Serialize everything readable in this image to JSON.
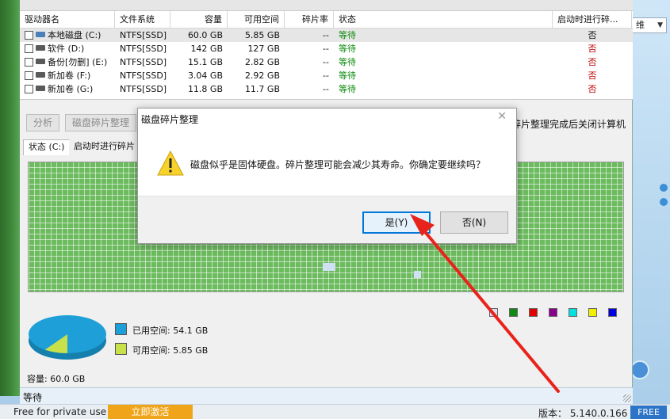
{
  "table": {
    "headers": [
      "驱动器名",
      "文件系统",
      "容量",
      "可用空间",
      "碎片率",
      "状态",
      "启动时进行碎..."
    ],
    "rows": [
      {
        "name": "本地磁盘 (C:)",
        "fs": "NTFS[SSD]",
        "capacity": "60.0 GB",
        "free": "5.85 GB",
        "frag": "--",
        "status": "等待",
        "boot": "否",
        "system": true
      },
      {
        "name": "软件 (D:)",
        "fs": "NTFS[SSD]",
        "capacity": "142 GB",
        "free": "127 GB",
        "frag": "--",
        "status": "等待",
        "boot": "否",
        "system": false
      },
      {
        "name": "备份[勿删] (E:)",
        "fs": "NTFS[SSD]",
        "capacity": "15.1 GB",
        "free": "2.82 GB",
        "frag": "--",
        "status": "等待",
        "boot": "否",
        "system": false
      },
      {
        "name": "新加卷 (F:)",
        "fs": "NTFS[SSD]",
        "capacity": "3.04 GB",
        "free": "2.92 GB",
        "frag": "--",
        "status": "等待",
        "boot": "否",
        "system": false
      },
      {
        "name": "新加卷 (G:)",
        "fs": "NTFS[SSD]",
        "capacity": "11.8 GB",
        "free": "11.7 GB",
        "frag": "--",
        "status": "等待",
        "boot": "否",
        "system": false
      }
    ]
  },
  "actions": {
    "analyze": "分析",
    "defrag": "磁盘碎片整理",
    "shutdown": "碎片整理完成后关闭计算机"
  },
  "tabs": {
    "status": "状态 (C:)",
    "boot": "启动时进行碎片"
  },
  "usage": {
    "used_label": "已用空间: 54.1 GB",
    "free_label": "可用空间: 5.85 GB",
    "used_value": 54.1,
    "free_value": 5.85,
    "used_color": "#1e9fd8",
    "free_color": "#c8e04a",
    "capacity": "容量: 60.0 GB"
  },
  "legend_colors": [
    "#e0e0f0",
    "#108a10",
    "#e00000",
    "#8b008b",
    "#00e0e0",
    "#f0f000",
    "#0000e0"
  ],
  "status_bar": "等待",
  "bottom": {
    "free_private": "Free for private use",
    "activate": "立即激活",
    "version": "版本：  5.140.0.166",
    "free_badge": "FREE"
  },
  "right_combo": "维",
  "dialog": {
    "title": "磁盘碎片整理",
    "message": "磁盘似乎是固体硬盘。碎片整理可能会减少其寿命。你确定要继续吗？",
    "yes": "是(Y)",
    "no": "否(N)"
  }
}
